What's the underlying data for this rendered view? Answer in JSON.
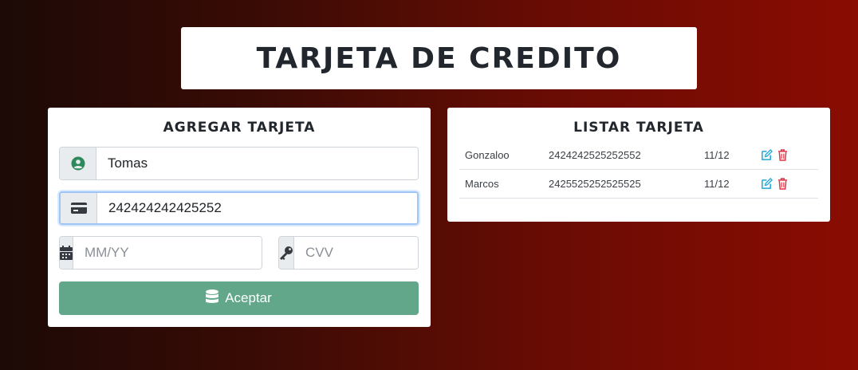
{
  "header": {
    "title": "TARJETA DE CREDITO"
  },
  "form": {
    "title": "AGREGAR TARJETA",
    "name_value": "Tomas",
    "number_value": "242424242425252",
    "expiry_placeholder": "MM/YY",
    "cvv_placeholder": "CVV",
    "submit_label": "Aceptar"
  },
  "list": {
    "title": "LISTAR TARJETA",
    "rows": [
      {
        "name": "Gonzaloo",
        "number": "2424242525252552",
        "expiry": "11/12"
      },
      {
        "name": "Marcos",
        "number": "2425525252525525",
        "expiry": "11/12"
      }
    ]
  },
  "colors": {
    "accept_button": "#63a78b",
    "edit_icon": "#1ea7d8",
    "delete_icon": "#dc3545",
    "user_icon": "#2e8a5c"
  }
}
